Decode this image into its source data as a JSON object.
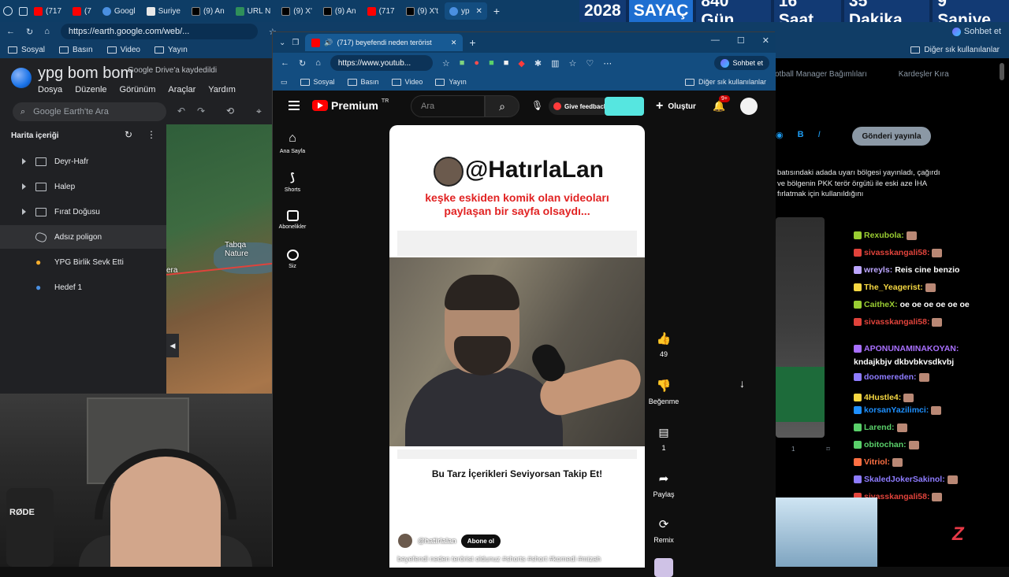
{
  "counter": {
    "year": "2028",
    "label": "SAYAÇ",
    "days": "840 Gün",
    "hours": "16 Saat",
    "minutes": "35 Dakika",
    "seconds": "9  Saniye"
  },
  "bg_browser": {
    "tabs": [
      "(717",
      "(7",
      "Googl",
      "Suriye",
      "(9) An",
      "URL N",
      "(9) X'",
      "(9) An",
      "(717",
      "(9) X't",
      "yp"
    ],
    "url": "https://earth.google.com/web/...",
    "bookmarks": [
      "Sosyal",
      "Basın",
      "Video",
      "Yayın"
    ],
    "right_bookmark": "Diğer sık kullanılanlar",
    "chat_button": "Sohbet et"
  },
  "earth": {
    "title": "ypg bom bom",
    "saved": "Google Drive'a kaydedildi",
    "menu": [
      "Dosya",
      "Düzenle",
      "Görünüm",
      "Araçlar",
      "Yardım"
    ],
    "search_placeholder": "Google Earth'te Ara",
    "panel_title": "Harita içeriği",
    "items": [
      {
        "label": "Deyr-Hafr",
        "type": "folder"
      },
      {
        "label": "Halep",
        "type": "folder"
      },
      {
        "label": "Fırat Doğusu",
        "type": "folder"
      },
      {
        "label": "Adsız poligon",
        "type": "polygon"
      },
      {
        "label": "YPG Birlik Sevk Etti",
        "type": "pin-orange"
      },
      {
        "label": "Hedef 1",
        "type": "pin-blue"
      }
    ],
    "map_label": "Tabqa Nature",
    "map_label2": "era"
  },
  "webcam": {
    "mic_brand": "RØDE"
  },
  "yt_browser": {
    "tab_title": "(717) beyefendi neden terörist",
    "url": "https://www.youtub...",
    "bookmarks": [
      "Sosyal",
      "Basın",
      "Video",
      "Yayın"
    ],
    "right_bookmark": "Diğer sık kullanılanlar",
    "chat_button": "Sohbet et"
  },
  "youtube": {
    "logo": "Premium",
    "logo_sup": "TR",
    "search_placeholder": "Ara",
    "feedback": "Give feedback",
    "create": "Oluştur",
    "notif_count": "9+",
    "guide": [
      "Ana Sayfa",
      "Shorts",
      "Abonelikler",
      "Siz"
    ],
    "short": {
      "handle": "@HatırlaLan",
      "subtitle_line1": "keşke eskiden komik olan videoları",
      "subtitle_line2": "paylaşan bir sayfa olsaydı...",
      "caption": "Bu Tarz İçerikleri Seviyorsan Takip Et!",
      "channel": "@hatirlalan",
      "subscribe": "Abone ol",
      "description": "beyefendi neden terörist oldunuz #shorts #short #komedi #mizah"
    },
    "actions": {
      "likes": "49",
      "dislike": "Beğenme",
      "comments": "1",
      "share": "Paylaş",
      "remix": "Remix"
    }
  },
  "twitter": {
    "tabs": [
      "otball Manager Bağımlıları",
      "Kardeşler Kıra"
    ],
    "post_button": "Gönderi yayınla",
    "text": "batısındaki adada uyarı bölgesi yayınladı, çağırdı ve bölgenin PKK terör örgütü ile eski aze İHA fırlatmak için kullanıldığını",
    "reply_count": "1"
  },
  "chat": [
    {
      "user": "Rexubola:",
      "color": "#9acd32",
      "msg": "",
      "emote": true
    },
    {
      "user": "sivasskangali58:",
      "color": "#e0433b",
      "msg": "",
      "emote": true
    },
    {
      "user": "wreyls:",
      "color": "#bca6ff",
      "msg": "Reis cine benzio",
      "emote": false
    },
    {
      "user": "The_Yeagerist:",
      "color": "#f5d742",
      "msg": "",
      "emote": true
    },
    {
      "user": "CaitheX:",
      "color": "#9acd32",
      "msg": "oe oe oe oe oe oe",
      "emote": false
    },
    {
      "user": "sivasskangali58:",
      "color": "#e0433b",
      "msg": "",
      "emote": true
    },
    {
      "user": "APONUNAMINAKOYAN:",
      "color": "#a970ff",
      "msg": "kndajkbjv dkbvbkvsdkvbj",
      "emote": false
    },
    {
      "user": "doomereden:",
      "color": "#8e7cff",
      "msg": "",
      "emote": true
    },
    {
      "user": "4Hustle4:",
      "color": "#f5d742",
      "msg": "",
      "emote": true
    },
    {
      "user": "korsanYazilimci:",
      "color": "#1e90ff",
      "msg": "",
      "emote": true
    },
    {
      "user": "Larend:",
      "color": "#5ad06a",
      "msg": "",
      "emote": true
    },
    {
      "user": "obitochan:",
      "color": "#5ad06a",
      "msg": "",
      "emote": true
    },
    {
      "user": "Vitriol:",
      "color": "#ff7043",
      "msg": "",
      "emote": true
    },
    {
      "user": "SkaledJokerSakinol:",
      "color": "#8e7cff",
      "msg": "",
      "emote": true
    },
    {
      "user": "sivasskangali58:",
      "color": "#e0433b",
      "msg": "",
      "emote": true
    }
  ],
  "colors": {
    "accent": "#1e6fd1",
    "youtube_red": "#ff0000",
    "earth_bg": "#202124"
  }
}
